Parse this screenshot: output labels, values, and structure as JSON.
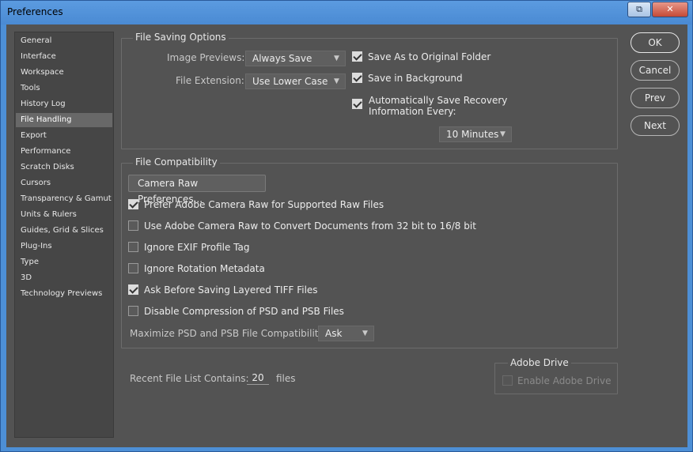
{
  "window": {
    "title": "Preferences"
  },
  "titlebar": {
    "min_glyph": "⧉",
    "close_glyph": "✕"
  },
  "sidebar": {
    "items": [
      {
        "label": "General"
      },
      {
        "label": "Interface"
      },
      {
        "label": "Workspace"
      },
      {
        "label": "Tools"
      },
      {
        "label": "History Log"
      },
      {
        "label": "File Handling",
        "active": true
      },
      {
        "label": "Export"
      },
      {
        "label": "Performance"
      },
      {
        "label": "Scratch Disks"
      },
      {
        "label": "Cursors"
      },
      {
        "label": "Transparency & Gamut"
      },
      {
        "label": "Units & Rulers"
      },
      {
        "label": "Guides, Grid & Slices"
      },
      {
        "label": "Plug-Ins"
      },
      {
        "label": "Type"
      },
      {
        "label": "3D"
      },
      {
        "label": "Technology Previews"
      }
    ]
  },
  "file_saving": {
    "title": "File Saving Options",
    "image_previews_label": "Image Previews:",
    "image_previews_value": "Always Save",
    "file_extension_label": "File Extension:",
    "file_extension_value": "Use Lower Case",
    "save_as_original_label": "Save As to Original Folder",
    "save_as_original_checked": true,
    "save_background_label": "Save in Background",
    "save_background_checked": true,
    "auto_save_label_1": "Automatically Save Recovery",
    "auto_save_label_2": "Information Every:",
    "auto_save_checked": true,
    "auto_save_interval": "10 Minutes"
  },
  "compat": {
    "title": "File Compatibility",
    "camera_raw_button": "Camera Raw Preferences...",
    "prefer_acr_label": "Prefer Adobe Camera Raw for Supported Raw Files",
    "prefer_acr_checked": true,
    "use_acr_label": "Use Adobe Camera Raw to Convert Documents from 32 bit to 16/8 bit",
    "use_acr_checked": false,
    "ignore_exif_label": "Ignore EXIF Profile Tag",
    "ignore_exif_checked": false,
    "ignore_rotation_label": "Ignore Rotation Metadata",
    "ignore_rotation_checked": false,
    "ask_tiff_label": "Ask Before Saving Layered TIFF Files",
    "ask_tiff_checked": true,
    "disable_compression_label": "Disable Compression of PSD and PSB Files",
    "disable_compression_checked": false,
    "maximize_label": "Maximize PSD and PSB File Compatibility:",
    "maximize_value": "Ask"
  },
  "recent": {
    "label": "Recent File List Contains:",
    "value": "20",
    "suffix": "files"
  },
  "adobe_drive": {
    "title": "Adobe Drive",
    "enable_label": "Enable Adobe Drive",
    "enabled": false
  },
  "buttons": {
    "ok": "OK",
    "cancel": "Cancel",
    "prev": "Prev",
    "next": "Next"
  }
}
